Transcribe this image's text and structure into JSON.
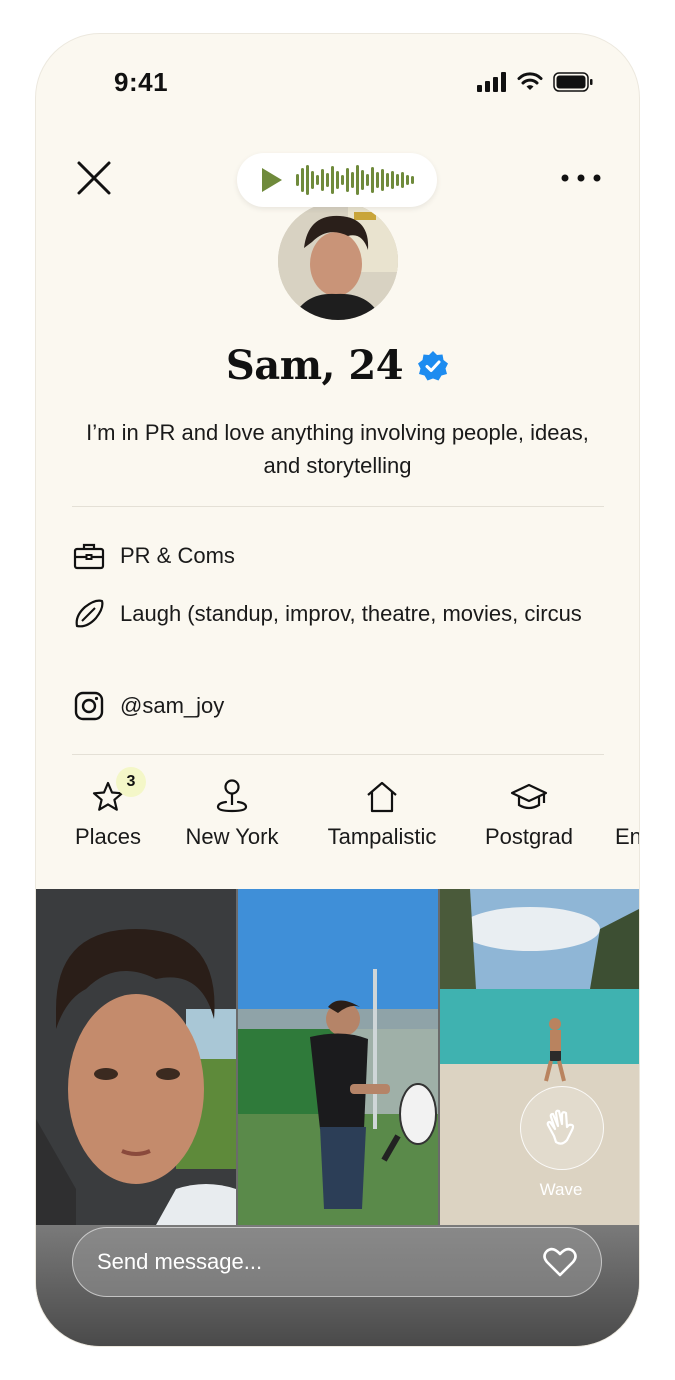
{
  "status_bar": {
    "time": "9:41"
  },
  "profile": {
    "name_age": "Sam, 24",
    "verified": true,
    "bio": "I’m in PR and love anything involving people, ideas, and storytelling"
  },
  "details": [
    {
      "icon": "briefcase-icon",
      "text": "PR & Coms"
    },
    {
      "icon": "surfboard-icon",
      "text": "Laugh (standup, improv, theatre, movies, circus"
    },
    {
      "icon": "instagram-icon",
      "text": "@sam_joy"
    }
  ],
  "chips": [
    {
      "icon": "star-icon",
      "label": "Places",
      "badge": "3"
    },
    {
      "icon": "location-pin-icon",
      "label": "New York"
    },
    {
      "icon": "house-icon",
      "label": "Tampalistic"
    },
    {
      "icon": "graduation-cap-icon",
      "label": "Postgrad"
    },
    {
      "icon": "",
      "label": "En"
    }
  ],
  "wave": {
    "label": "Wave"
  },
  "message": {
    "placeholder": "Send message..."
  },
  "colors": {
    "background": "#fbf8f0",
    "verified_blue": "#1d8cf0",
    "play_green": "#6f8a3b",
    "badge_yellow": "#f4f7c8"
  }
}
